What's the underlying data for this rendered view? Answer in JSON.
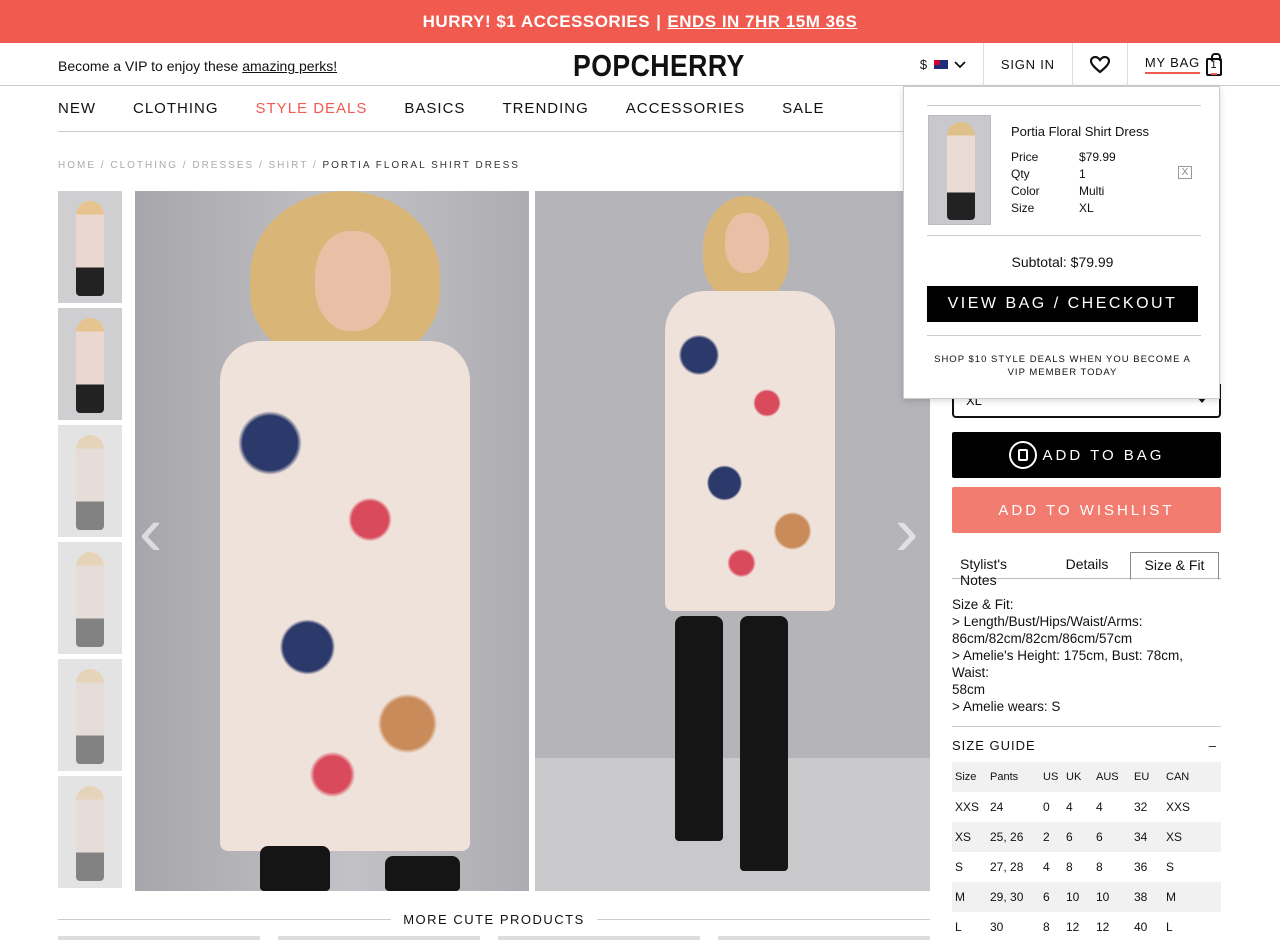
{
  "promo": {
    "text": "HURRY! $1 ACCESSORIES",
    "sep": "|",
    "timer": "ENDS IN 7HR 15M 36S"
  },
  "header": {
    "vip_text": "Become a VIP to enjoy these",
    "vip_link": "amazing perks!",
    "logo": "POPCHERRY",
    "currency": "$",
    "sign_in": "SIGN IN",
    "my_bag": "MY BAG",
    "bag_count": "1"
  },
  "nav": [
    "NEW",
    "CLOTHING",
    "STYLE DEALS",
    "BASICS",
    "TRENDING",
    "ACCESSORIES",
    "SALE"
  ],
  "breadcrumb": {
    "home": "HOME",
    "clothing": "CLOTHING",
    "dresses": "DRESSES",
    "shirt": "SHIRT",
    "current": "PORTIA FLORAL SHIRT DRESS",
    "sep": "/"
  },
  "gallery": {
    "prev": "‹",
    "next": "›"
  },
  "more_products": "MORE CUTE PRODUCTS",
  "product": {
    "size_value": "XL",
    "add_to_bag": "ADD TO BAG",
    "add_to_wishlist": "ADD TO WISHLIST",
    "tabs": [
      "Stylist's Notes",
      "Details",
      "Size & Fit"
    ],
    "size_fit": [
      "Size & Fit:",
      "> Length/Bust/Hips/Waist/Arms:",
      "86cm/82cm/82cm/86cm/57cm",
      "> Amelie's Height: 175cm, Bust: 78cm, Waist:",
      "58cm",
      "> Amelie wears: S"
    ]
  },
  "size_guide": {
    "title": "SIZE GUIDE",
    "toggle": "–",
    "headers": [
      "Size",
      "Pants",
      "US",
      "UK",
      "AUS",
      "EU",
      "CAN"
    ],
    "rows": [
      [
        "XXS",
        "24",
        "0",
        "4",
        "4",
        "32",
        "XXS"
      ],
      [
        "XS",
        "25, 26",
        "2",
        "6",
        "6",
        "34",
        "XS"
      ],
      [
        "S",
        "27, 28",
        "4",
        "8",
        "8",
        "36",
        "S"
      ],
      [
        "M",
        "29, 30",
        "6",
        "10",
        "10",
        "38",
        "M"
      ],
      [
        "L",
        "30",
        "8",
        "12",
        "12",
        "40",
        "L"
      ]
    ]
  },
  "bag_dropdown": {
    "product_name": "Portia Floral Shirt Dress",
    "price_label": "Price",
    "price": "$79.99",
    "qty_label": "Qty",
    "qty": "1",
    "color_label": "Color",
    "color": "Multi",
    "size_label": "Size",
    "size": "XL",
    "remove": "X",
    "subtotal": "Subtotal: $79.99",
    "checkout": "VIEW BAG / CHECKOUT",
    "vip_line1": "SHOP $10 STYLE DEALS WHEN YOU BECOME A",
    "vip_line2": "VIP MEMBER TODAY"
  },
  "colors": {
    "accent": "#f05a4f",
    "wishlist": "#f27c6f"
  }
}
